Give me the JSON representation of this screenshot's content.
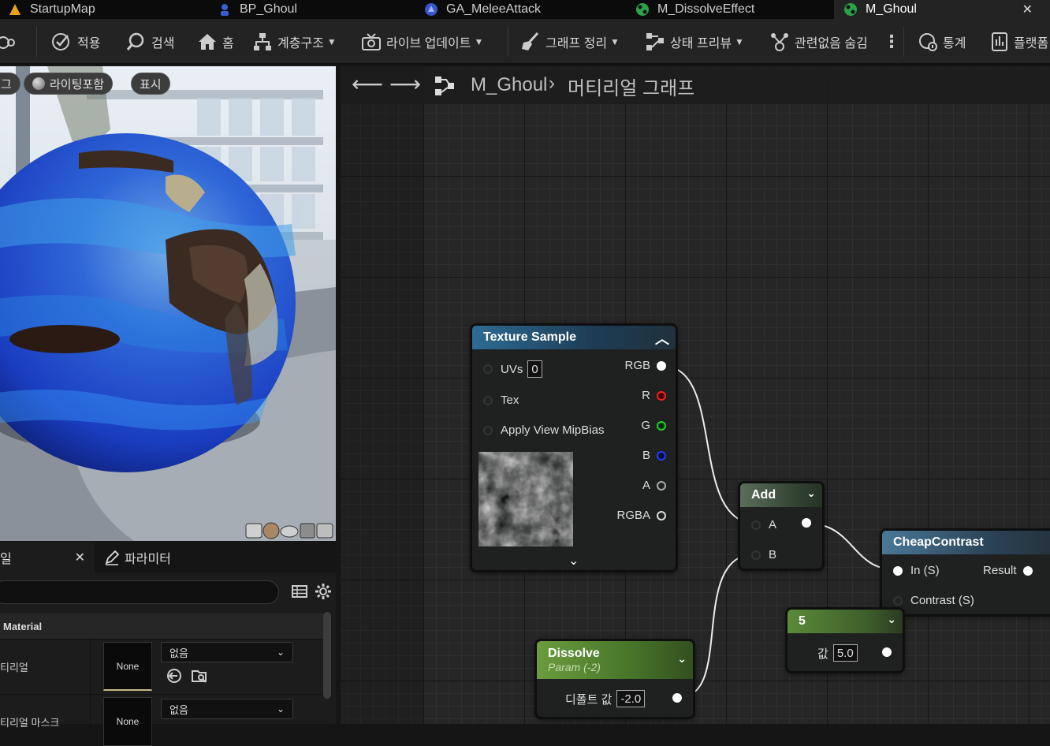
{
  "tabs": [
    {
      "label": "StartupMap",
      "icon": "level-icon"
    },
    {
      "label": "BP_Ghoul",
      "icon": "blueprint-icon"
    },
    {
      "label": "GA_MeleeAttack",
      "icon": "gameplay-ability-icon"
    },
    {
      "label": "M_DissolveEffect",
      "icon": "material-icon"
    },
    {
      "label": "M_Ghoul",
      "icon": "material-icon"
    }
  ],
  "toolbar": {
    "apply": "적용",
    "search": "검색",
    "home": "홈",
    "hierarchy": "계층구조",
    "live_update": "라이브 업데이트",
    "clean_graph": "그래프 정리",
    "preview_state": "상태 프리뷰",
    "hide_unrelated": "관련없음 숨김",
    "stats": "통계",
    "platform": "플랫폼"
  },
  "viewport": {
    "left_btn": "그",
    "lit_btn": "라이팅포함",
    "show_btn": "표시"
  },
  "details": {
    "tab_details": "일",
    "tab_params": "파라미터",
    "section": "Material",
    "row1_label": "티리얼",
    "row1_thumb": "None",
    "row1_combo": "없음",
    "row2_label": "티리얼 마스크",
    "row2_thumb": "None",
    "row2_combo": "없음"
  },
  "graph": {
    "crumb_asset": "M_Ghoul",
    "crumb_graph": "머티리얼 그래프",
    "texture_sample": {
      "title": "Texture Sample",
      "uvs": "UVs",
      "uvs_value": "0",
      "tex": "Tex",
      "mipbias": "Apply View MipBias",
      "outputs": [
        "RGB",
        "R",
        "G",
        "B",
        "A",
        "RGBA"
      ]
    },
    "add": {
      "title": "Add",
      "a": "A",
      "b": "B"
    },
    "cheap_contrast": {
      "title": "CheapContrast",
      "in": "In (S)",
      "contrast": "Contrast (S)",
      "result": "Result"
    },
    "const": {
      "title": "5",
      "label": "값",
      "value": "5.0"
    },
    "dissolve": {
      "title": "Dissolve",
      "subtitle": "Param (-2)",
      "label": "디폴트 값",
      "value": "-2.0"
    }
  },
  "colors": {
    "pin_r": "#ff2020",
    "pin_g": "#22d322",
    "pin_b": "#2040ff",
    "accent_blue": "#3a82c4"
  }
}
